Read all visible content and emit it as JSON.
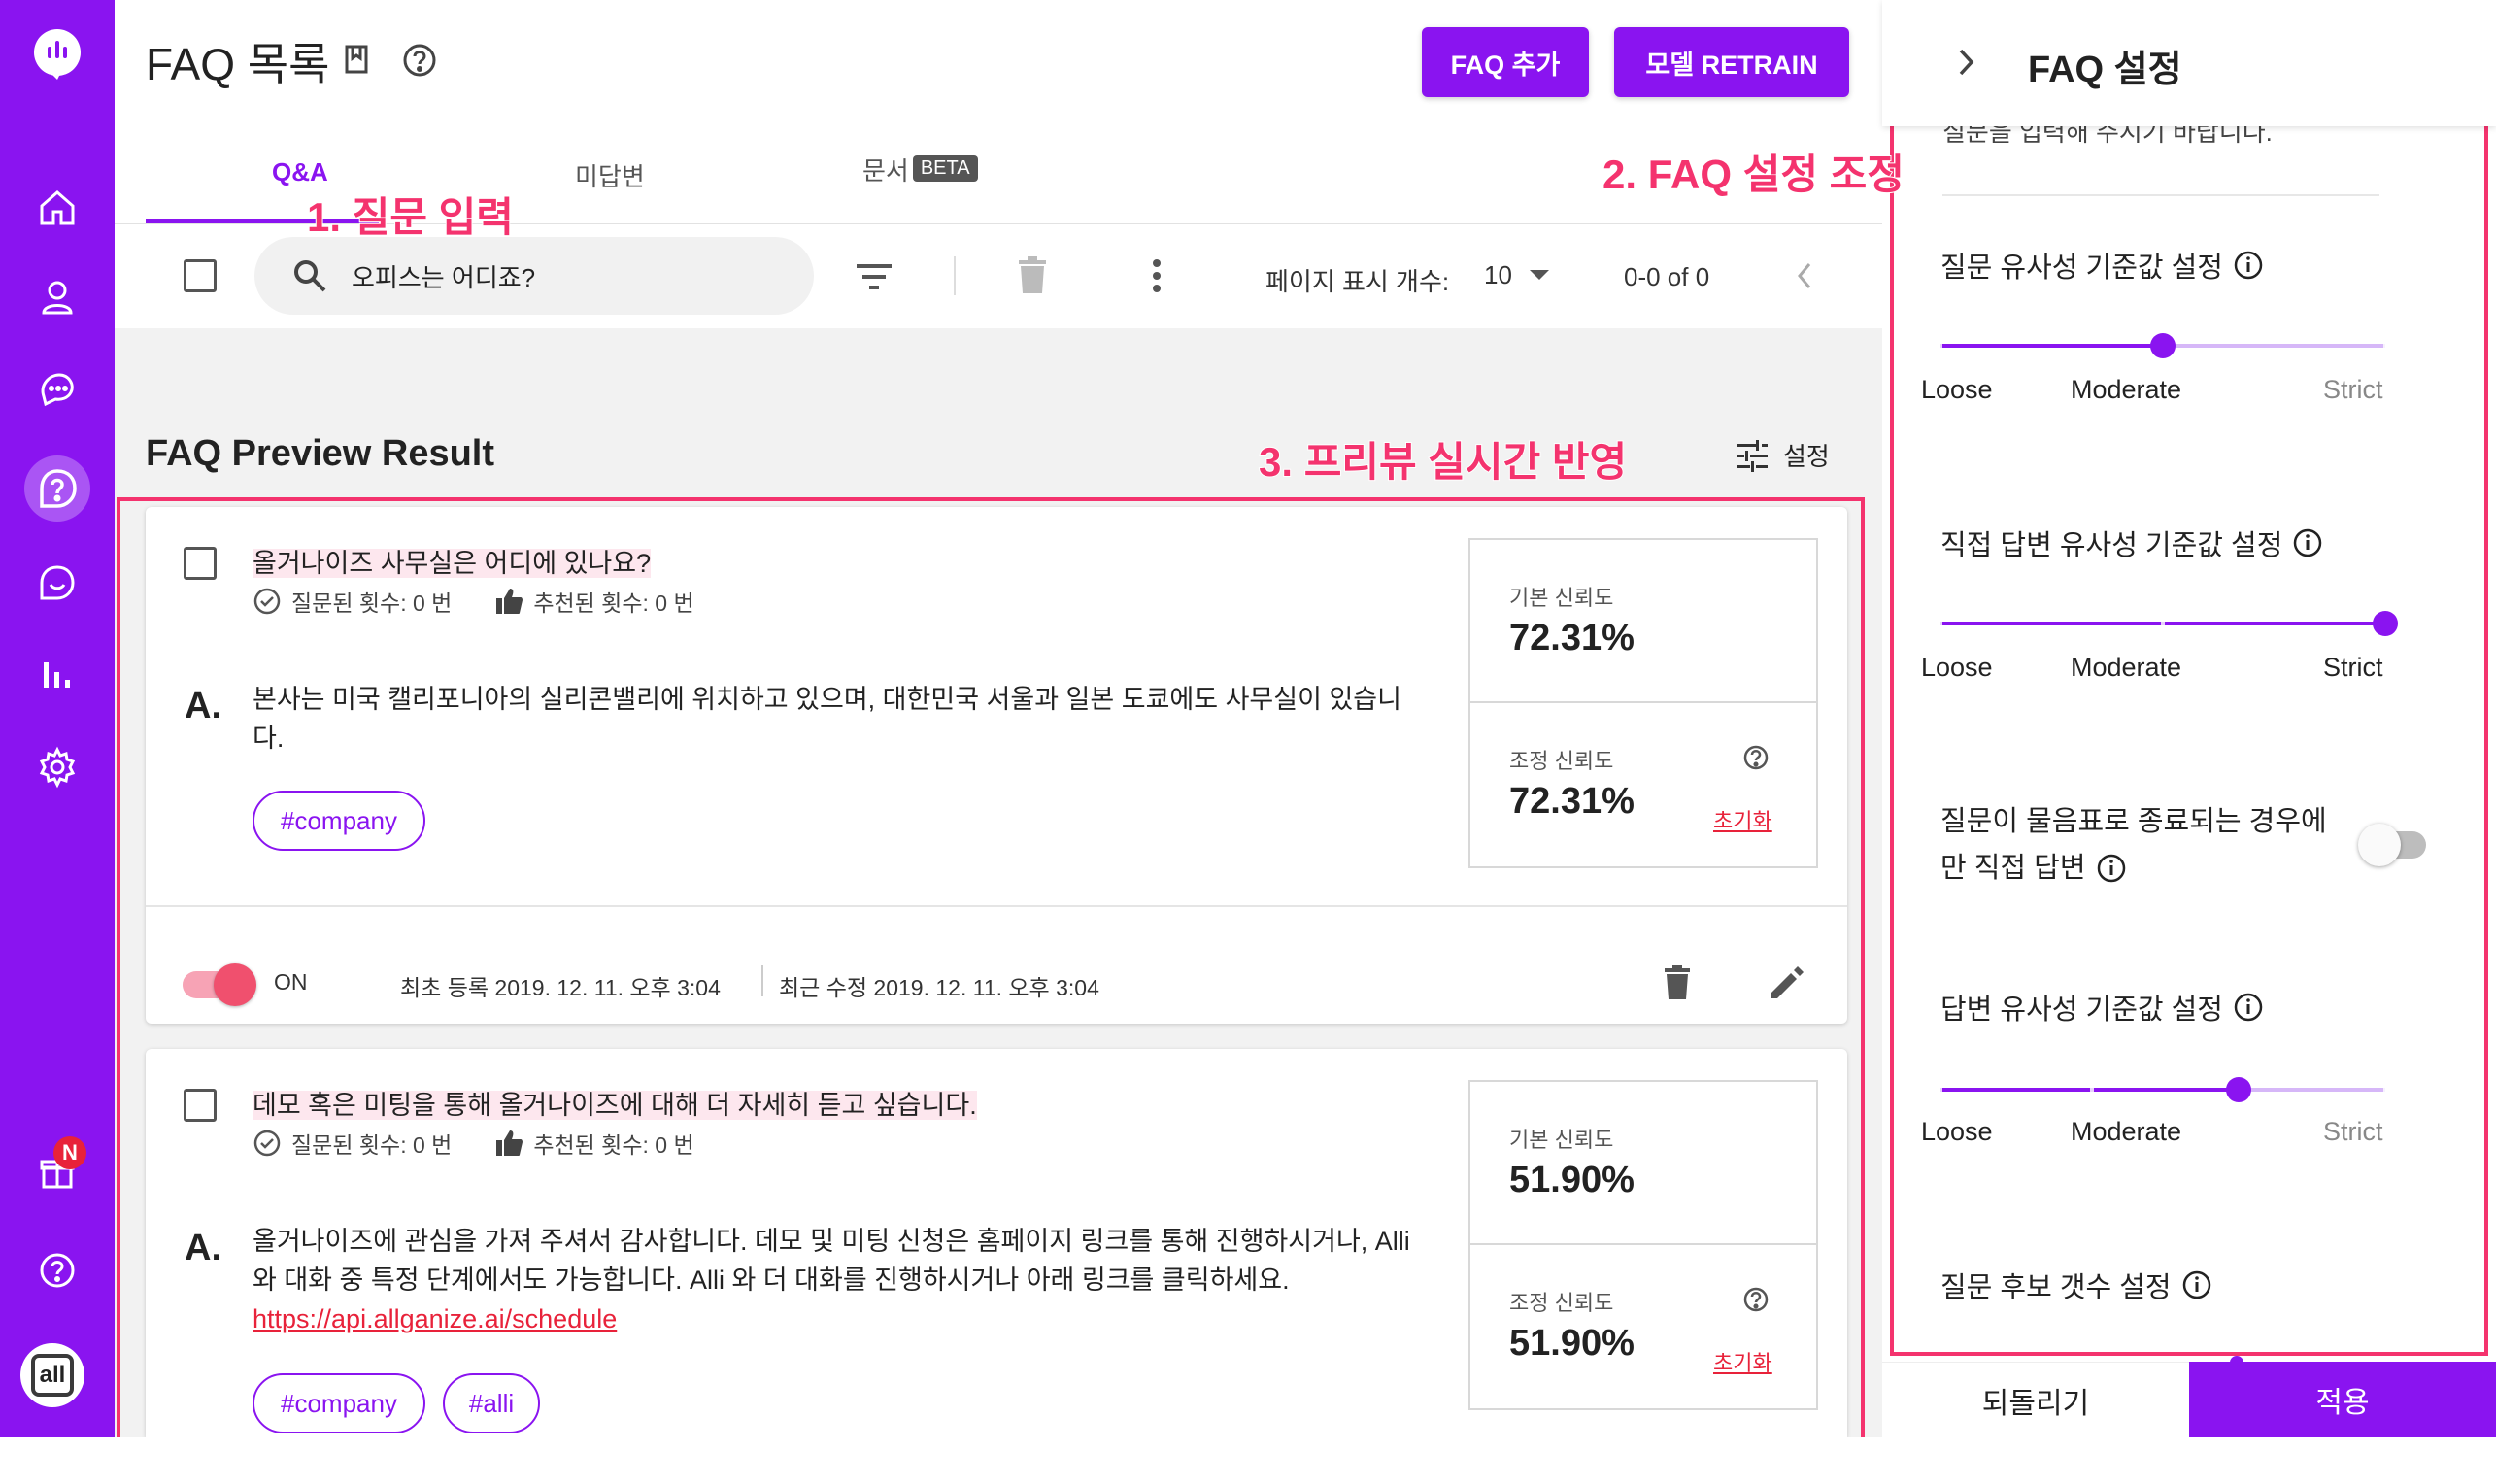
{
  "header": {
    "title": "FAQ 목록",
    "add_button": "FAQ 추가",
    "retrain_button": "모델 RETRAIN"
  },
  "tabs": [
    {
      "label": "Q&A",
      "active": true
    },
    {
      "label": "미답변",
      "active": false
    },
    {
      "label": "문서",
      "badge": "BETA",
      "active": false
    }
  ],
  "toolbar": {
    "search_value": "오피스는 어디죠?",
    "page_size_label": "페이지 표시 개수:",
    "page_size_value": "10",
    "pagination": "0-0 of 0"
  },
  "preview": {
    "title": "FAQ Preview Result",
    "settings_label": "설정"
  },
  "faqs": [
    {
      "question": "올거나이즈 사무실은 어디에 있나요?",
      "asked": "질문된 횟수: 0 번",
      "recommended": "추천된 횟수: 0 번",
      "answer_label": "A.",
      "answer": "본사는 미국 캘리포니아의 실리콘밸리에 위치하고 있으며, 대한민국 서울과 일본 도쿄에도 사무실이 있습니다.",
      "tags": [
        "#company"
      ],
      "base_confidence_label": "기본 신뢰도",
      "base_confidence": "72.31%",
      "adjusted_confidence_label": "조정 신뢰도",
      "adjusted_confidence": "72.31%",
      "reset_label": "초기화",
      "toggle_label": "ON",
      "created": "최초 등록 2019. 12. 11. 오후 3:04",
      "modified": "최근 수정 2019. 12. 11. 오후 3:04"
    },
    {
      "question": "데모 혹은 미팅을 통해 올거나이즈에 대해 더 자세히 듣고 싶습니다.",
      "asked": "질문된 횟수: 0 번",
      "recommended": "추천된 횟수: 0 번",
      "answer_label": "A.",
      "answer_line1": "올거나이즈에 관심을 가져 주셔서 감사합니다. 데모 및 미팅 신청은 홈페이지 링크를 통해 진행하시거나, Alli",
      "answer_line2": "와 대화 중 특정 단계에서도 가능합니다. Alli 와 더 대화를 진행하시거나 아래 링크를 클릭하세요.",
      "answer_link": "https://api.allganize.ai/schedule",
      "tags": [
        "#company",
        "#alli"
      ],
      "base_confidence_label": "기본 신뢰도",
      "base_confidence": "51.90%",
      "adjusted_confidence_label": "조정 신뢰도",
      "adjusted_confidence": "51.90%",
      "reset_label": "초기화"
    }
  ],
  "settings_panel": {
    "title": "FAQ 설정",
    "cut_text": "질문을 입력해 주시기 바랍니다.",
    "question_similarity_label": "질문 유사성 기준값 설정",
    "question_similarity_level": 0.5,
    "direct_answer_similarity_label": "직접 답변 유사성 기준값 설정",
    "direct_answer_similarity_level": 1.0,
    "question_mark_label_line1": "질문이 물음표로 종료되는 경우에",
    "question_mark_label_line2": "만 직접 답변",
    "question_mark_toggle": false,
    "answer_similarity_label": "답변 유사성 기준값 설정",
    "answer_similarity_level": 0.67,
    "candidate_count_label": "질문 후보 갯수 설정",
    "scale_loose": "Loose",
    "scale_moderate": "Moderate",
    "scale_strict": "Strict",
    "revert_button": "되돌리기",
    "apply_button": "적용"
  },
  "annotations": {
    "step1": "1. 질문 입력",
    "step2": "2. FAQ 설정 조정",
    "step3": "3. 프리뷰 실시간 반영"
  },
  "colors": {
    "brand": "#8a14f0",
    "annotation": "#f4336e",
    "link": "#e8223a"
  }
}
